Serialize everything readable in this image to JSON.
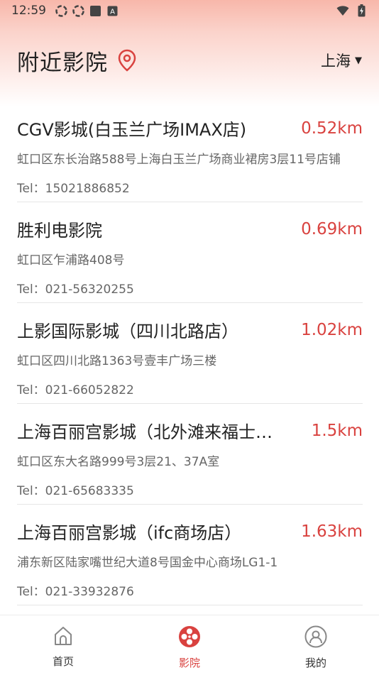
{
  "status": {
    "time": "12:59",
    "app_badge": "A"
  },
  "header": {
    "title": "附近影院",
    "city": "上海"
  },
  "cinemas": [
    {
      "name": "CGV影城(白玉兰广场IMAX店)",
      "distance": "0.52km",
      "address": "虹口区东长治路588号上海白玉兰广场商业裙房3层11号店铺",
      "tel": "Tel：15021886852"
    },
    {
      "name": "胜利电影院",
      "distance": "0.69km",
      "address": "虹口区乍浦路408号",
      "tel": "Tel：021-56320255"
    },
    {
      "name": "上影国际影城（四川北路店）",
      "distance": "1.02km",
      "address": "虹口区四川北路1363号壹丰广场三楼",
      "tel": "Tel：021-66052822"
    },
    {
      "name": "上海百丽宫影城（北外滩来福士广场店）",
      "distance": "1.5km",
      "address": "虹口区东大名路999号3层21、37A室",
      "tel": "Tel：021-65683335"
    },
    {
      "name": "上海百丽宫影城（ifc商场店）",
      "distance": "1.63km",
      "address": "浦东新区陆家嘴世纪大道8号国金中心商场LG1-1",
      "tel": "Tel：021-33932876"
    }
  ],
  "tabs": [
    {
      "label": "首页",
      "icon": "home-icon",
      "active": false
    },
    {
      "label": "影院",
      "icon": "film-reel-icon",
      "active": true
    },
    {
      "label": "我的",
      "icon": "user-icon",
      "active": false
    }
  ],
  "colors": {
    "accent": "#d9423f",
    "text": "#222222",
    "secondary_text": "#666666"
  }
}
